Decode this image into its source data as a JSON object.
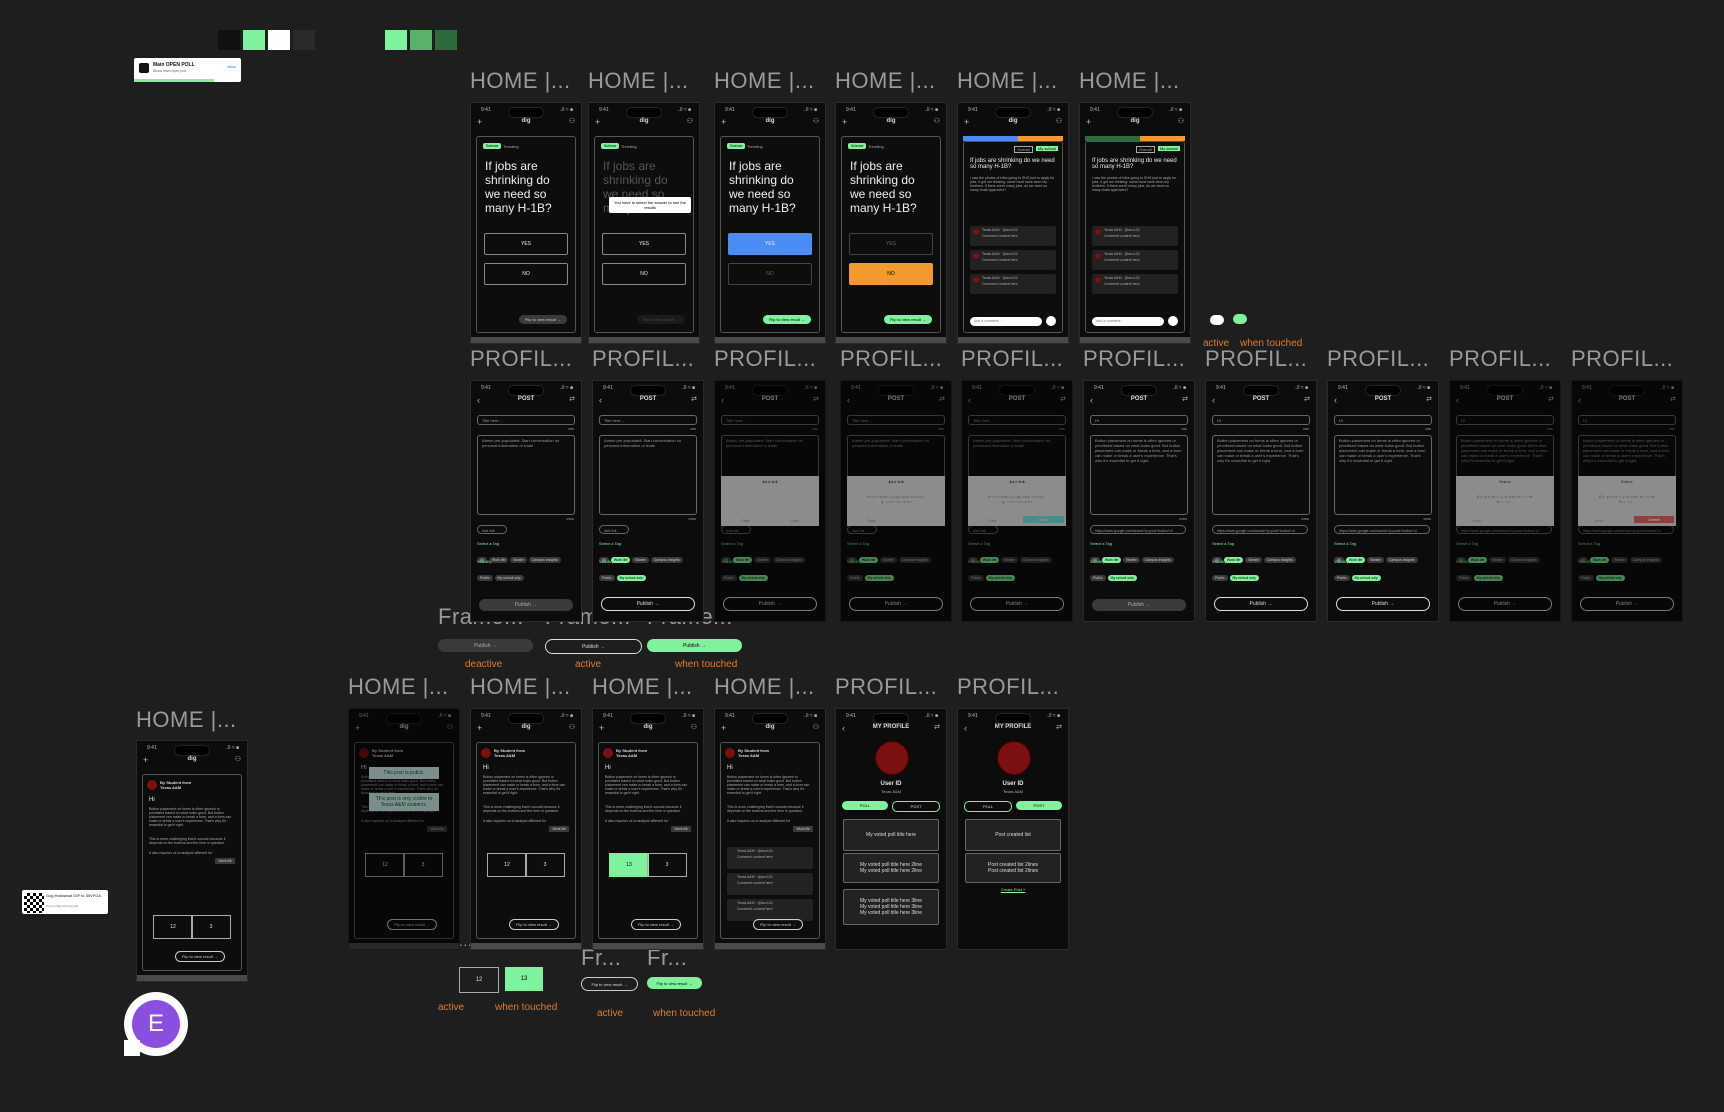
{
  "colors": {
    "accent_green": "#7ef29d",
    "blue": "#4a8cf2",
    "orange": "#f39a2e",
    "red": "#e04040",
    "canvas": "#1e1e1e"
  },
  "swatches_top": [
    "#111111",
    "#7ef29d",
    "#ffffff",
    "#2a2a2a"
  ],
  "swatches_green": [
    "#7ef29d",
    "#55b46a",
    "#2e6b3c"
  ],
  "component": {
    "title": "Main OPEN POLL",
    "subtitle": "About main open poll",
    "link": "Inbox"
  },
  "gif_component": {
    "title": "Gog Hollowout GIF to 30VFGA",
    "sub": "Prop to flag with the poll"
  },
  "frame_labels": {
    "row1": [
      "HOME |...",
      "HOME |...",
      "HOME |...",
      "HOME |...",
      "HOME |...",
      "HOME |..."
    ],
    "row2": [
      "PROFIL...",
      "PROFIL...",
      "PROFIL...",
      "PROFIL...",
      "PROFIL...",
      "PROFIL...",
      "PROFIL...",
      "PROFIL...",
      "PROFIL...",
      "PROFIL..."
    ],
    "frames": [
      "Frame...",
      "Frame...",
      "Frame..."
    ],
    "row3": [
      "HOME |...",
      "HOME |...",
      "HOME |...",
      "HOME |...",
      "PROFIL...",
      "PROFIL..."
    ],
    "left": "HOME |...",
    "fr": [
      "Fr...",
      "Fr..."
    ],
    "dots": [
      "...",
      "..."
    ]
  },
  "phone": {
    "time": "9:41",
    "logo": "dig",
    "signal": "..ll ≈ ■"
  },
  "poll": {
    "badge": "Science",
    "badge2": "Trending",
    "question": "If jobs are shrinking do we need so many H-1B?",
    "yes": "YES",
    "no": "NO",
    "flip": "Flip to view result →",
    "modal": "You have to select the answer to see the results",
    "small_question": "If jobs are shrinking do we need so many H-1B?",
    "small_body": "I saw the photos of folks going to SHG just to apply for jobs. It got me thinking: some must have been my brothers. If there aren't many jobs, do we need so many chalk approvers?",
    "comment_user": "Texas A&M · @anc102",
    "comment_text": "Comment content here",
    "add_comment": "Add a comment...",
    "tab_overall": "Overall",
    "tab_school": "My school"
  },
  "post": {
    "header": "POST",
    "title_ph": "Title here...",
    "title_val": "Hi",
    "body_ph": "Admin pre-populated: Start conversation no personal information or trade",
    "body_text": "Button placement on forms is often ignored or prioritised based on what looks good. But button placement can make or break a form, and a form can make or break a user's experience. That's why it's essential to get it right.",
    "add_link": "Add link",
    "link_val": "https://www.google.com/search?q=post+button+ui",
    "counter": "0/50",
    "counter2": "0/500",
    "select_tag": "Select a Tag",
    "tags": [
      "All",
      "Work life",
      "Banter",
      "Campus insights"
    ],
    "visibility": "Visibility",
    "vis": [
      "Public",
      "My school only"
    ],
    "publish": "Publish →",
    "dialog_add_title": "Add link",
    "back": "Back",
    "save": "Save",
    "dialog_delete_title": "Delete",
    "delete_q": "Are you sure you want to delete this link?",
    "cancel": "Cancel",
    "delete": "Delete"
  },
  "publish_states": {
    "labels": [
      "deactive",
      "active",
      "when touched"
    ],
    "button": "Publish →"
  },
  "toggle_states": {
    "labels": [
      "active",
      "when touched"
    ]
  },
  "feed": {
    "user": "By Student from Texas A&M",
    "hi": "Hi",
    "body": "Button placement on forms is often ignored or prioritised based on what looks good. But button placement can make or break a form, and a form can make or break a user's experience. That's why it's essential to get it right.",
    "body2": "This is more challenging that it sounds because it depends on the buttons and the form in question.",
    "body3": "It also requires us to analyse different for",
    "worklife": "Work life",
    "likes": "12",
    "likes2": "13",
    "comments": "3",
    "flip": "Flip to view result →",
    "public": "This post is public.",
    "visible": "This post is only visible to Texas A&M students."
  },
  "like_states": {
    "labels": [
      "active",
      "when touched"
    ],
    "a": "12",
    "b": "13"
  },
  "flip_states": {
    "labels": [
      "active",
      "when touched"
    ],
    "button": "Flip to view result →"
  },
  "profile": {
    "title": "MY PROFILE",
    "user": "User ID",
    "school": "Texas A&M",
    "tab_poll": "POLL",
    "tab_post": "POST",
    "poll_items": [
      "My voted poll title here",
      "My voted poll title here 2line\nMy voted poll title here 2line",
      "My voted poll title here 3line\nMy voted poll title here 3line\nMy voted poll title here 3line"
    ],
    "post_items": [
      "Post created list",
      "Post created list 2lines\nPost created list 2lines"
    ],
    "create": "Create Post +"
  },
  "avatar_letter": "E"
}
